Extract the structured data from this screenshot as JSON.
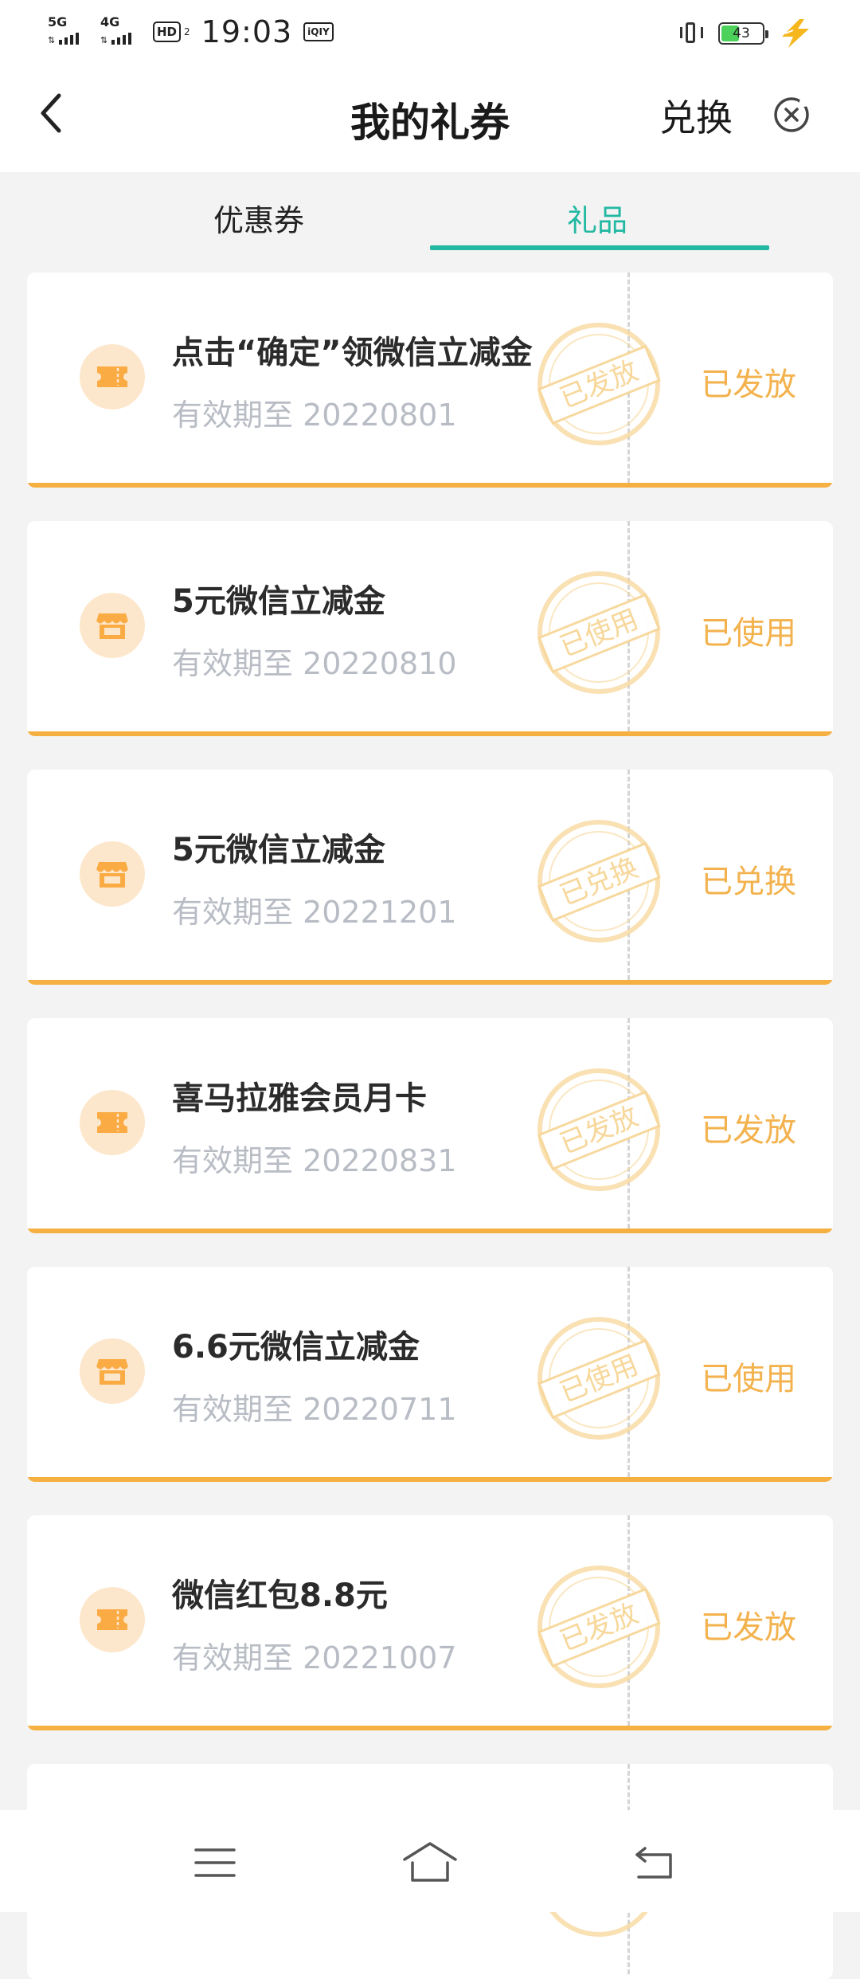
{
  "status_bar": {
    "net1": "5G",
    "net2": "4G",
    "hd": "HD",
    "hd_sub": "2",
    "time": "19:03",
    "app_badge": "iQIY",
    "battery": "43"
  },
  "header": {
    "title": "我的礼券",
    "redeem": "兑换"
  },
  "tabs": {
    "coupons": "优惠券",
    "gifts": "礼品",
    "active": "gifts"
  },
  "cards": [
    {
      "title": "点击“确定”领微信立减金",
      "expiry": "有效期至 20220801",
      "stamp": "已发放",
      "status": "已发放",
      "icon": "ticket-icon"
    },
    {
      "title": "5元微信立减金",
      "expiry": "有效期至 20220810",
      "stamp": "已使用",
      "status": "已使用",
      "icon": "store-icon"
    },
    {
      "title": "5元微信立减金",
      "expiry": "有效期至 20221201",
      "stamp": "已兑换",
      "status": "已兑换",
      "icon": "store-icon"
    },
    {
      "title": "喜马拉雅会员月卡",
      "expiry": "有效期至 20220831",
      "stamp": "已发放",
      "status": "已发放",
      "icon": "ticket-icon"
    },
    {
      "title": "6.6元微信立减金",
      "expiry": "有效期至 20220711",
      "stamp": "已使用",
      "status": "已使用",
      "icon": "store-icon"
    },
    {
      "title": "微信红包8.8元",
      "expiry": "有效期至 20221007",
      "stamp": "已发放",
      "status": "已发放",
      "icon": "ticket-icon"
    }
  ],
  "colors": {
    "accent": "#22b8a2",
    "status": "#f3b24d",
    "bottom_line": "#f5b041",
    "icon_bg": "#fde7cc",
    "icon": "#fbab43"
  }
}
